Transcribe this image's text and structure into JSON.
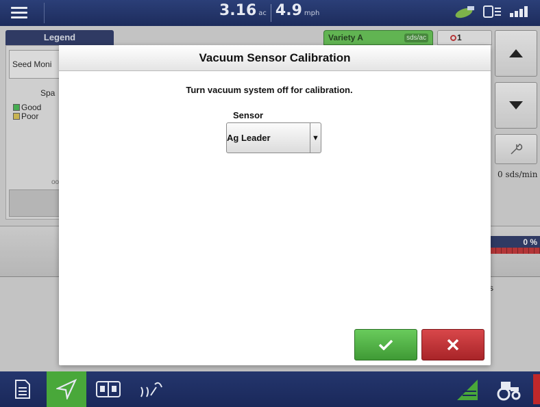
{
  "topbar": {
    "area_value": "3.16",
    "area_unit": "ac",
    "speed_value": "4.9",
    "speed_unit": "mph"
  },
  "legend": {
    "tab_label": "Legend",
    "seed_button_label": "Seed Moni",
    "section_title": "Spa",
    "items": [
      {
        "label": "Good",
        "color": "#3cb84a"
      },
      {
        "label": "Poor",
        "color": "#d9c14a"
      }
    ],
    "dots": "oo"
  },
  "product": {
    "variety_label": "Variety A",
    "variety_units": "sds/ac",
    "alarm_count": "1"
  },
  "right_panel": {
    "seed_rate": "0 sds/min",
    "progress_percent": "0 %"
  },
  "map": {
    "partial_text": "s"
  },
  "dialog": {
    "title": "Vacuum Sensor Calibration",
    "instruction": "Turn vacuum system off for calibration.",
    "sensor_label": "Sensor",
    "sensor_value": "Ag Leader",
    "ok_color": "#4caf3f",
    "cancel_color": "#c0282a"
  },
  "colors": {
    "topbar": "#1d2c5c",
    "accent_green": "#49a83a"
  }
}
